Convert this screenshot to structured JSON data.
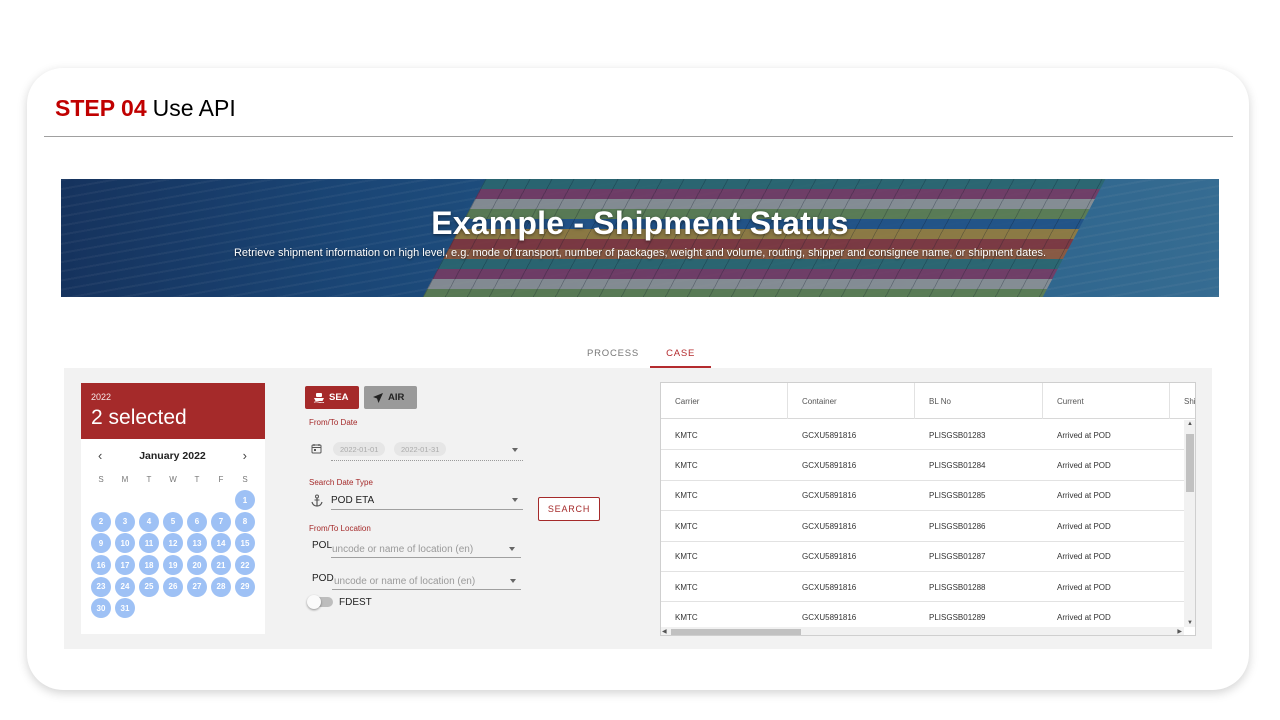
{
  "slide": {
    "step_label": "STEP 04",
    "step_title": "Use API"
  },
  "banner": {
    "title": "Example - Shipment Status",
    "subtitle": "Retrieve shipment information on high level, e.g. mode of transport, number of packages, weight and volume, routing, shipper and consignee name, or shipment dates."
  },
  "tabs": [
    {
      "label": "PROCESS",
      "active": false
    },
    {
      "label": "CASE",
      "active": true
    }
  ],
  "calendar": {
    "year": "2022",
    "selected_text": "2 selected",
    "month_label": "January 2022",
    "prev_icon": "chevron-left-icon",
    "next_icon": "chevron-right-icon",
    "weekdays": [
      "S",
      "M",
      "T",
      "W",
      "T",
      "F",
      "S"
    ],
    "first_weekday_index": 6,
    "days": [
      "1",
      "2",
      "3",
      "4",
      "5",
      "6",
      "7",
      "8",
      "9",
      "10",
      "11",
      "12",
      "13",
      "14",
      "15",
      "16",
      "17",
      "18",
      "19",
      "20",
      "21",
      "22",
      "23",
      "24",
      "25",
      "26",
      "27",
      "28",
      "29",
      "30",
      "31"
    ]
  },
  "mode": {
    "sea_label": "SEA",
    "air_label": "AIR",
    "sea_icon": "ship-icon",
    "air_icon": "airplane-icon",
    "selected": "SEA"
  },
  "form": {
    "from_to_date_label": "From/To Date",
    "date_from": "2022-01-01",
    "date_to": "2022-01-31",
    "search_date_type_label": "Search Date Type",
    "search_date_type_value": "POD ETA",
    "from_to_location_label": "From/To Location",
    "pol_label": "POL",
    "pol_placeholder": "uncode or name of location (en)",
    "pod_label": "POD",
    "pod_placeholder": "uncode or name of location (en)",
    "fdest_label": "FDEST",
    "fdest_enabled": false,
    "search_button": "SEARCH"
  },
  "table": {
    "columns": [
      "Carrier",
      "Container",
      "BL No",
      "Current",
      "Shi"
    ],
    "rows": [
      [
        "KMTC",
        "GCXU5891816",
        "PLISGSB01283",
        "Arrived at POD"
      ],
      [
        "KMTC",
        "GCXU5891816",
        "PLISGSB01284",
        "Arrived at POD"
      ],
      [
        "KMTC",
        "GCXU5891816",
        "PLISGSB01285",
        "Arrived at POD"
      ],
      [
        "KMTC",
        "GCXU5891816",
        "PLISGSB01286",
        "Arrived at POD"
      ],
      [
        "KMTC",
        "GCXU5891816",
        "PLISGSB01287",
        "Arrived at POD"
      ],
      [
        "KMTC",
        "GCXU5891816",
        "PLISGSB01288",
        "Arrived at POD"
      ],
      [
        "KMTC",
        "GCXU5891816",
        "PLISGSB01289",
        "Arrived at POD"
      ]
    ]
  },
  "colors": {
    "accent": "#a52a2a",
    "step_red": "#c00000",
    "day_blue": "#9ec1f5"
  }
}
